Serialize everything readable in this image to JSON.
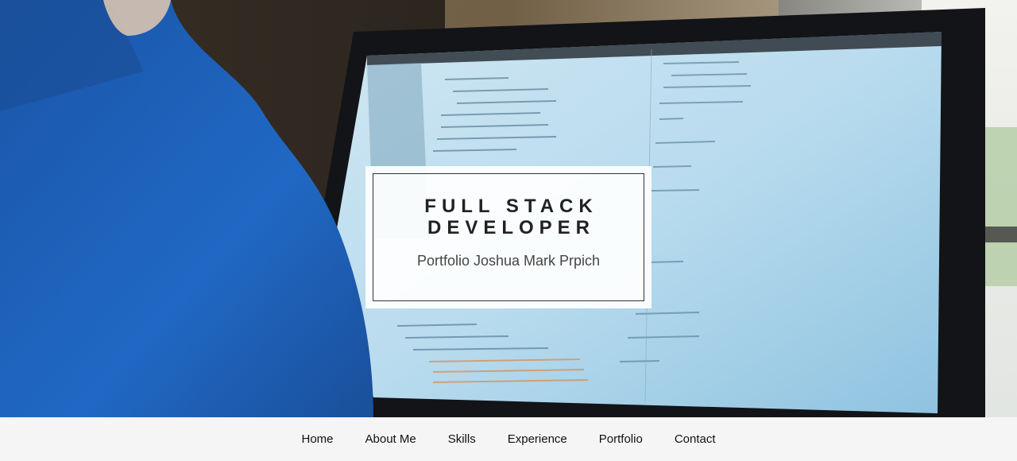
{
  "hero": {
    "title_line_1": "FULL STACK",
    "title_line_2": "DEVELOPER",
    "subtitle": "Portfolio Joshua Mark Prpich"
  },
  "nav": {
    "items": [
      {
        "label": "Home"
      },
      {
        "label": "About Me"
      },
      {
        "label": "Skills"
      },
      {
        "label": "Experience"
      },
      {
        "label": "Portfolio"
      },
      {
        "label": "Contact"
      }
    ]
  },
  "colors": {
    "card_background": "#ffffff",
    "card_border": "#333333",
    "title_text": "#222222",
    "subtitle_text": "#444444",
    "nav_background": "#f5f5f5",
    "nav_text": "#111111",
    "shirt_blue": "#1f5fb5",
    "screen_blue": "#b9dcee"
  }
}
